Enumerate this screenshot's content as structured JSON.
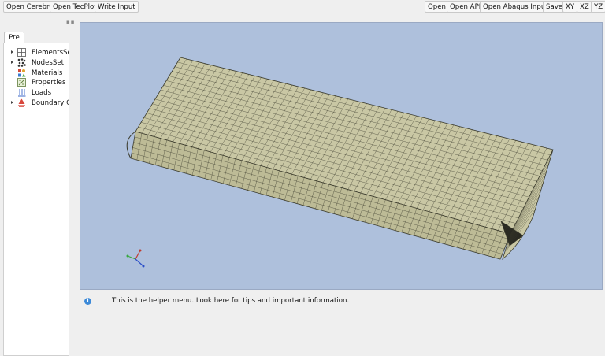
{
  "toolbar": {
    "left": [
      "Open Cerebro",
      "Open TecPlot",
      "Write Input"
    ],
    "right": [
      "Open",
      "Open API",
      "Open Abaqus Input",
      "Save",
      "XY",
      "XZ",
      "YZ"
    ]
  },
  "panel": {
    "tab": "Pre",
    "tree": [
      {
        "label": "ElementsSet",
        "icon": "grid-icon",
        "expandable": true
      },
      {
        "label": "NodesSet",
        "icon": "nodes-icon",
        "expandable": true
      },
      {
        "label": "Materials",
        "icon": "materials-icon",
        "expandable": false
      },
      {
        "label": "Properties",
        "icon": "properties-icon",
        "expandable": false
      },
      {
        "label": "Loads",
        "icon": "loads-icon",
        "expandable": false
      },
      {
        "label": "Boundary Conditions",
        "icon": "boundary-icon",
        "expandable": true
      }
    ]
  },
  "viewport": {
    "background": "#aec0dc",
    "mesh_fill": "#c9c7a4",
    "mesh_line": "#3a3a2c",
    "axes": [
      "x",
      "y",
      "z"
    ]
  },
  "helper": {
    "text": "This is the helper menu. Look here for tips and important information."
  }
}
